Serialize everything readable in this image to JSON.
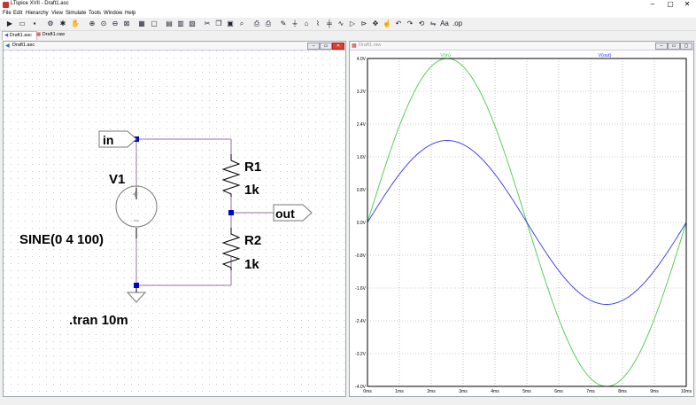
{
  "window": {
    "title": "LTspice XVII - Draft1.asc",
    "min": "–",
    "max": "▢",
    "close": "✕"
  },
  "menu": [
    "File",
    "Edit",
    "Hierarchy",
    "View",
    "Simulate",
    "Tools",
    "Window",
    "Help"
  ],
  "tabs": [
    {
      "label": "Draft1.asc"
    },
    {
      "label": "Draft1.raw"
    }
  ],
  "schematic": {
    "title": "Draft1.asc",
    "components": {
      "source_name": "V1",
      "source_value": "SINE(0 4 100)",
      "r1_name": "R1",
      "r1_value": "1k",
      "r2_name": "R2",
      "r2_value": "1k"
    },
    "labels": {
      "in": "in",
      "out": "out"
    },
    "directive": ".tran 10m"
  },
  "waveform": {
    "title": "Draft1.raw",
    "colors": {
      "vin": "#44cc44",
      "vout": "#3333ee"
    },
    "chart_data": {
      "type": "line",
      "series": [
        {
          "name": "V(in)",
          "amplitude": 4.0,
          "frequency_hz": 100
        },
        {
          "name": "V(out)",
          "amplitude": 2.0,
          "frequency_hz": 100
        }
      ],
      "x_ticks": [
        "0ms",
        "1ms",
        "2ms",
        "3ms",
        "4ms",
        "5ms",
        "6ms",
        "7ms",
        "8ms",
        "9ms",
        "10ms"
      ],
      "y_ticks": [
        "4.0V",
        "3.2V",
        "2.4V",
        "1.6V",
        "0.8V",
        "0.0V",
        "-0.8V",
        "-1.6V",
        "-2.4V",
        "-3.2V",
        "-4.0V"
      ],
      "xlim": [
        0,
        10
      ],
      "ylim": [
        -4,
        4
      ],
      "grid": true
    }
  }
}
